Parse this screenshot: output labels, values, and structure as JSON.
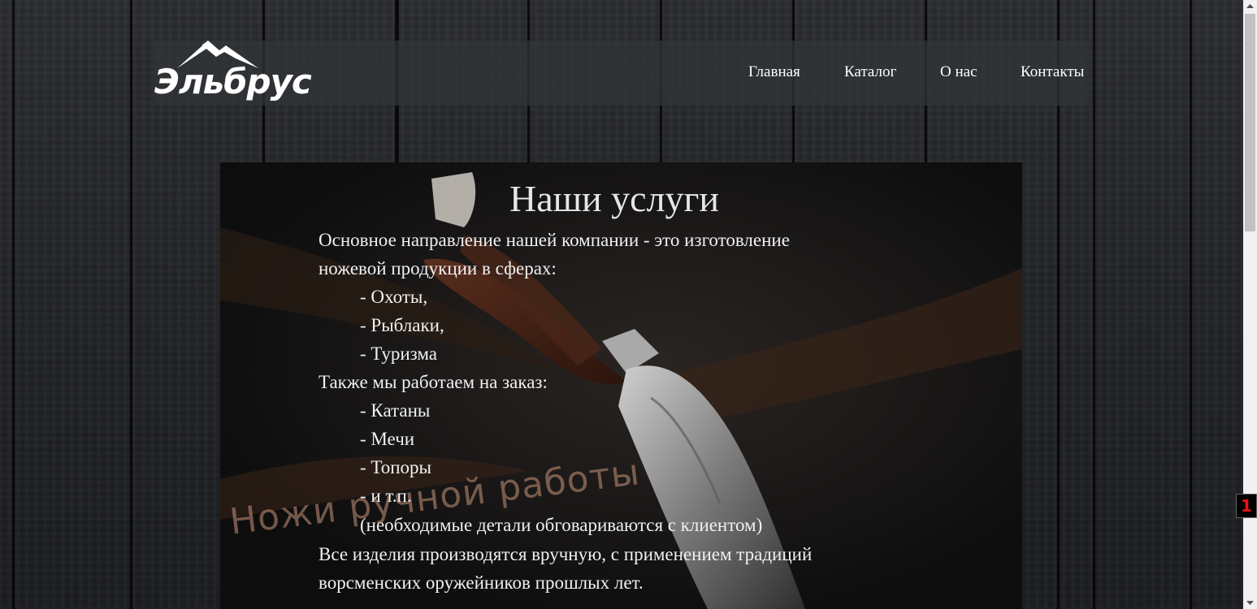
{
  "logo": {
    "text": "Эльбрус",
    "icon": "mountain-icon"
  },
  "nav": [
    {
      "label": "Главная"
    },
    {
      "label": "Каталог"
    },
    {
      "label": "О нас"
    },
    {
      "label": "Контакты"
    }
  ],
  "services": {
    "title": "Наши услуги",
    "watermark": "Ножи ручной работы",
    "lines": [
      "Основное направление нашей компании - это изготовление",
      "ножевой продукции в сферах:",
      "- Охоты,",
      "- Рыблаки,",
      "- Туризма",
      "Также мы работаем на заказ:",
      "- Катаны",
      "- Мечи",
      "- Топоры",
      "- и т.п.",
      "(необходимые детали обговариваются с клиентом)",
      "Все изделия производятся вручную, с применением традиций",
      "ворсменских оружейников прошлых лет."
    ]
  },
  "scrollbar": {
    "up_icon": "chevron-up-icon",
    "down_icon": "chevron-down-icon"
  },
  "badge": {
    "text": "1"
  },
  "colors": {
    "background": "#1c1e22",
    "header": "#323438",
    "panel": "#0f0f10",
    "text": "#f0f0f0",
    "badge": "#ee1111"
  }
}
